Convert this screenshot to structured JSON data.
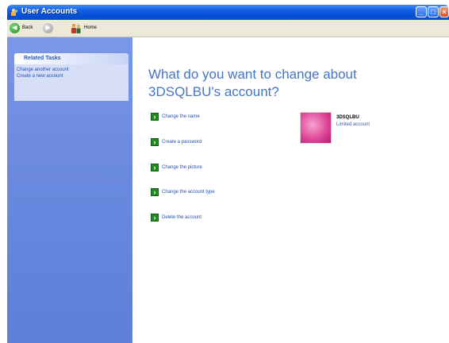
{
  "window": {
    "title": "User Accounts"
  },
  "toolbar": {
    "back_label": "Back",
    "home_label": "Home"
  },
  "sidebar": {
    "panel_title": "Related Tasks",
    "links": [
      "Change another account",
      "Create a new account"
    ]
  },
  "main": {
    "heading_line1": "What do you want to change about",
    "heading_line2": "3DSQLBU's account?",
    "options": [
      "Change the name",
      "Create a password",
      "Change the picture",
      "Change the account type",
      "Delete the account"
    ],
    "user": {
      "name": "3DSQLBU",
      "type": "Limited account"
    }
  }
}
